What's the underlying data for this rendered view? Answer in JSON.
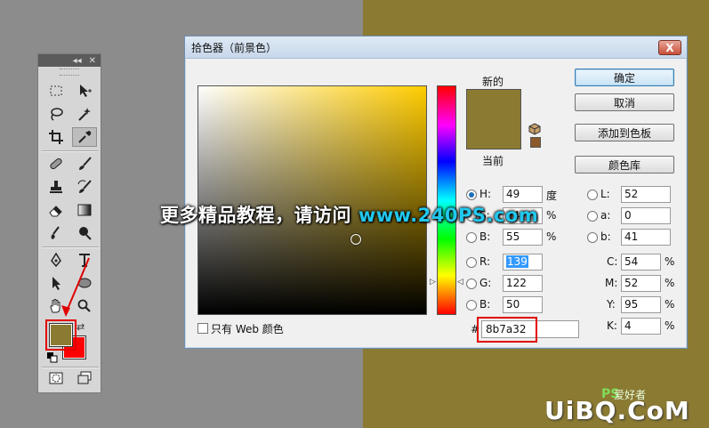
{
  "dialog": {
    "title": "拾色器（前景色）",
    "close_label": "X",
    "labels": {
      "new": "新的",
      "current": "当前"
    },
    "buttons": {
      "ok": "确定",
      "cancel": "取消",
      "add_to_swatches": "添加到色板",
      "libraries": "颜色库"
    },
    "hsb": [
      {
        "key": "H:",
        "value": "49",
        "unit": "度"
      },
      {
        "key": "S:",
        "value": "64",
        "unit": "%"
      },
      {
        "key": "B:",
        "value": "55",
        "unit": "%"
      }
    ],
    "rgb": [
      {
        "key": "R:",
        "value": "139"
      },
      {
        "key": "G:",
        "value": "122"
      },
      {
        "key": "B:",
        "value": "50"
      }
    ],
    "lab": [
      {
        "key": "L:",
        "value": "52"
      },
      {
        "key": "a:",
        "value": "0"
      },
      {
        "key": "b:",
        "value": "41"
      }
    ],
    "cmyk": [
      {
        "key": "C:",
        "value": "54",
        "unit": "%"
      },
      {
        "key": "M:",
        "value": "52",
        "unit": "%"
      },
      {
        "key": "Y:",
        "value": "95",
        "unit": "%"
      },
      {
        "key": "K:",
        "value": "4",
        "unit": "%"
      }
    ],
    "hex_label": "#",
    "hex_value": "8b7a32",
    "web_colors_label": "只有 Web 颜色",
    "hue_marker": "▷",
    "hue_marker_r": "◁"
  },
  "toolbox": {
    "collapse": "◂◂",
    "close": "✕",
    "swap": "⇄"
  },
  "watermark": {
    "text": "更多精品教程，请访问 ",
    "site": "www.240PS.com"
  },
  "brand": {
    "main": "UiBQ.CoM",
    "ps": "PS",
    "sub": "爱好者"
  },
  "colors": {
    "foreground": "#8b7a32",
    "background": "#ff0000",
    "accent": "#e20000"
  }
}
